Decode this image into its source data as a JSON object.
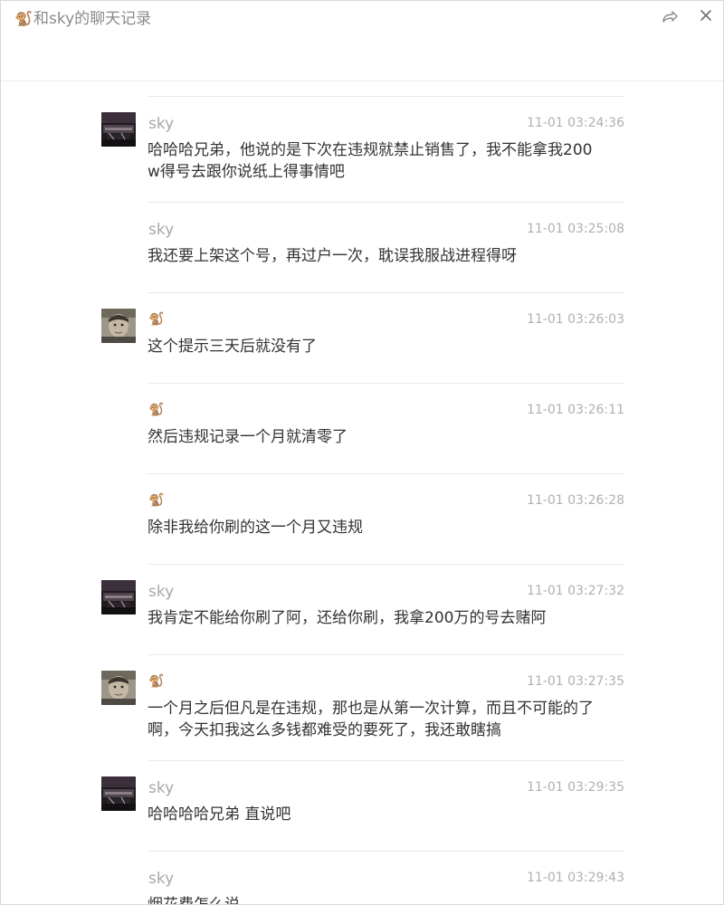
{
  "window": {
    "title": "和sky的聊天记录",
    "title_icon": "🐒",
    "share_icon": "share-icon",
    "close_icon": "close-icon"
  },
  "messages": [
    {
      "sender": "sky",
      "avatar": "sky-avatar",
      "time": "11-01 03:24:36",
      "text": "哈哈哈兄弟，他说的是下次在违规就禁止销售了，我不能拿我200w得号去跟你说纸上得事情吧"
    },
    {
      "sender": "sky",
      "avatar": null,
      "time": "11-01 03:25:08",
      "text": "我还要上架这个号，再过户一次，耽误我服战进程得呀"
    },
    {
      "sender": "🐒",
      "avatar": "self-avatar",
      "time": "11-01 03:26:03",
      "text": "这个提示三天后就没有了"
    },
    {
      "sender": "🐒",
      "avatar": null,
      "time": "11-01 03:26:11",
      "text": "然后违规记录一个月就清零了"
    },
    {
      "sender": "🐒",
      "avatar": null,
      "time": "11-01 03:26:28",
      "text": "除非我给你刷的这一个月又违规"
    },
    {
      "sender": "sky",
      "avatar": "sky-avatar",
      "time": "11-01 03:27:32",
      "text": "我肯定不能给你刷了阿，还给你刷，我拿200万的号去赌阿"
    },
    {
      "sender": "🐒",
      "avatar": "self-avatar",
      "time": "11-01 03:27:35",
      "text": "一个月之后但凡是在违规，那也是从第一次计算，而且不可能的了啊，今天扣我这么多钱都难受的要死了，我还敢瞎搞"
    },
    {
      "sender": "sky",
      "avatar": "sky-avatar",
      "time": "11-01 03:29:35",
      "text": "哈哈哈哈兄弟 直说吧"
    },
    {
      "sender": "sky",
      "avatar": null,
      "time": "11-01 03:29:43",
      "text": "烟花费怎么说"
    }
  ],
  "colors": {
    "sender_text": "#a8a8a8",
    "time_text": "#b0b0b0",
    "message_text": "#333333",
    "separator": "#e9e9e9"
  }
}
